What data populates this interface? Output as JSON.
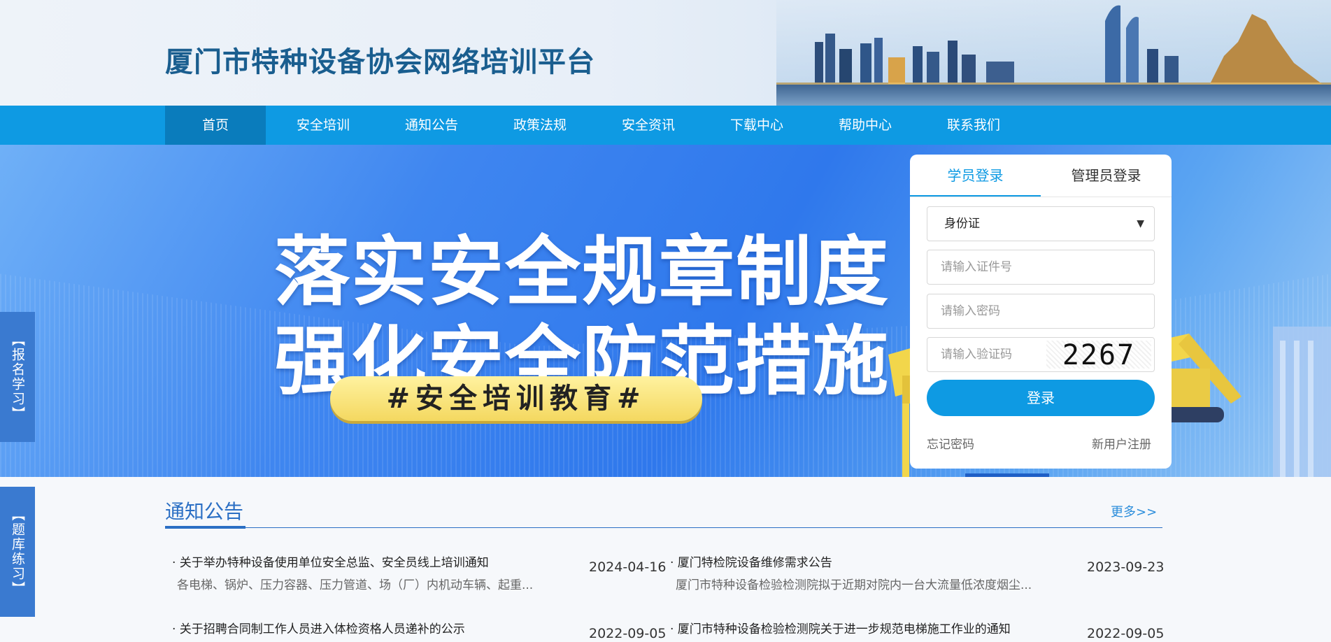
{
  "header": {
    "site_title": "厦门市特种设备协会网络培训平台"
  },
  "nav": {
    "items": [
      {
        "label": "首页",
        "active": true
      },
      {
        "label": "安全培训",
        "active": false
      },
      {
        "label": "通知公告",
        "active": false
      },
      {
        "label": "政策法规",
        "active": false
      },
      {
        "label": "安全资讯",
        "active": false
      },
      {
        "label": "下载中心",
        "active": false
      },
      {
        "label": "帮助中心",
        "active": false
      },
      {
        "label": "联系我们",
        "active": false
      }
    ]
  },
  "banner": {
    "line1": "落实安全规章制度",
    "line2": "强化安全防范措施",
    "tag": "#安全培训教育#"
  },
  "login": {
    "tabs": [
      "学员登录",
      "管理员登录"
    ],
    "active_tab": 0,
    "id_type_selected": "身份证",
    "id_placeholder": "请输入证件号",
    "password_placeholder": "请输入密码",
    "captcha_placeholder": "请输入验证码",
    "captcha_text": "2267",
    "submit_label": "登录",
    "forgot_label": "忘记密码",
    "register_label": "新用户注册"
  },
  "side_tabs": {
    "signup": "【报名学习】",
    "practice": "【题库练习】"
  },
  "notices": {
    "title": "通知公告",
    "more": "更多>>",
    "items": [
      {
        "title": "· 关于举办特种设备使用单位安全总监、安全员线上培训通知",
        "summary": "各电梯、锅炉、压力容器、压力管道、场（厂）内机动车辆、起重...",
        "date": "2024-04-16"
      },
      {
        "title": "· 厦门特检院设备维修需求公告",
        "summary": "厦门市特种设备检验检测院拟于近期对院内一台大流量低浓度烟尘...",
        "date": "2023-09-23"
      },
      {
        "title": "· 关于招聘合同制工作人员进入体检资格人员递补的公示",
        "summary": "",
        "date": "2022-09-05"
      },
      {
        "title": "· 厦门市特种设备检验检测院关于进一步规范电梯施工作业的通知",
        "summary": "",
        "date": "2022-09-05"
      }
    ]
  },
  "colors": {
    "primary": "#0e9ae3",
    "nav_active": "#0a7cbc",
    "section_blue": "#2b6fc4",
    "side_tab": "#3a7ad0"
  }
}
